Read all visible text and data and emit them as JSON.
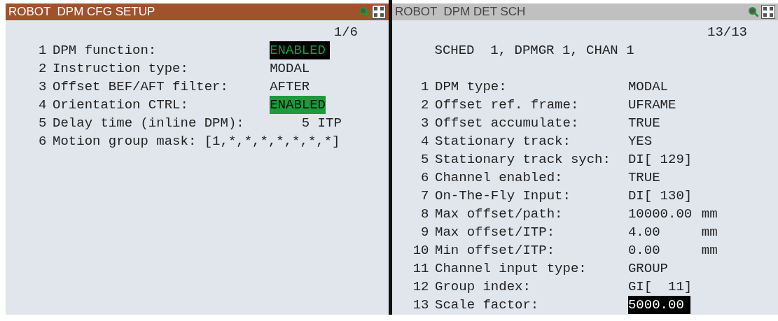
{
  "panes": [
    {
      "title": "ROBOT  DPM CFG SETUP",
      "active": true,
      "page": "1/6",
      "items": [
        {
          "number": "1",
          "label": "DPM function:",
          "value": "ENABLED",
          "selected": true,
          "on": true
        },
        {
          "number": "2",
          "label": "Instruction type:",
          "value": "MODAL",
          "selected": false,
          "on": false
        },
        {
          "number": "3",
          "label": "Offset BEF/AFT filter:",
          "value": "AFTER",
          "selected": false,
          "on": false
        },
        {
          "number": "4",
          "label": "Orientation CTRL:",
          "value": "ENABLED",
          "selected": false,
          "on": true
        },
        {
          "number": "5",
          "label": "Delay time (inline DPM):",
          "value": "    5 ITP",
          "selected": false,
          "on": false
        },
        {
          "number": "6",
          "label": "Motion group mask: [1,*,*,*,*,*,*,*]"
        }
      ]
    },
    {
      "title": "ROBOT  DPM DET SCH",
      "active": false,
      "page": "13/13",
      "header": "SCHED  1, DPMGR 1, CHAN 1",
      "items": [
        {
          "number": "1",
          "label": "DPM type:",
          "value": "MODAL",
          "selected": false
        },
        {
          "number": "2",
          "label": "Offset ref. frame:",
          "value": "UFRAME",
          "selected": false
        },
        {
          "number": "3",
          "label": "Offset accumulate:",
          "value": "TRUE",
          "selected": false
        },
        {
          "number": "4",
          "label": "Stationary track:",
          "value": "YES",
          "selected": false
        },
        {
          "number": "5",
          "label": "Stationary track sych:",
          "value": "DI[ 129]",
          "selected": false
        },
        {
          "number": "6",
          "label": "Channel enabled:",
          "value": "TRUE",
          "selected": false
        },
        {
          "number": "7",
          "label": "On-The-Fly Input:",
          "value": "DI[ 130]",
          "selected": false
        },
        {
          "number": "8",
          "label": "Max offset/path:",
          "value": "10000.00",
          "unit": "mm",
          "selected": false
        },
        {
          "number": "9",
          "label": "Max offset/ITP:",
          "value": "4.00",
          "unit": "mm",
          "selected": false
        },
        {
          "number": "10",
          "label": "Min offset/ITP:",
          "value": "0.00",
          "unit": "mm",
          "selected": false
        },
        {
          "number": "11",
          "label": "Channel input type:",
          "value": "GROUP",
          "selected": false
        },
        {
          "number": "12",
          "label": "Group index:",
          "value": "GI[  11]",
          "selected": false
        },
        {
          "number": "13",
          "label": "Scale factor:",
          "value": "5000.00",
          "selected": true
        }
      ]
    }
  ]
}
